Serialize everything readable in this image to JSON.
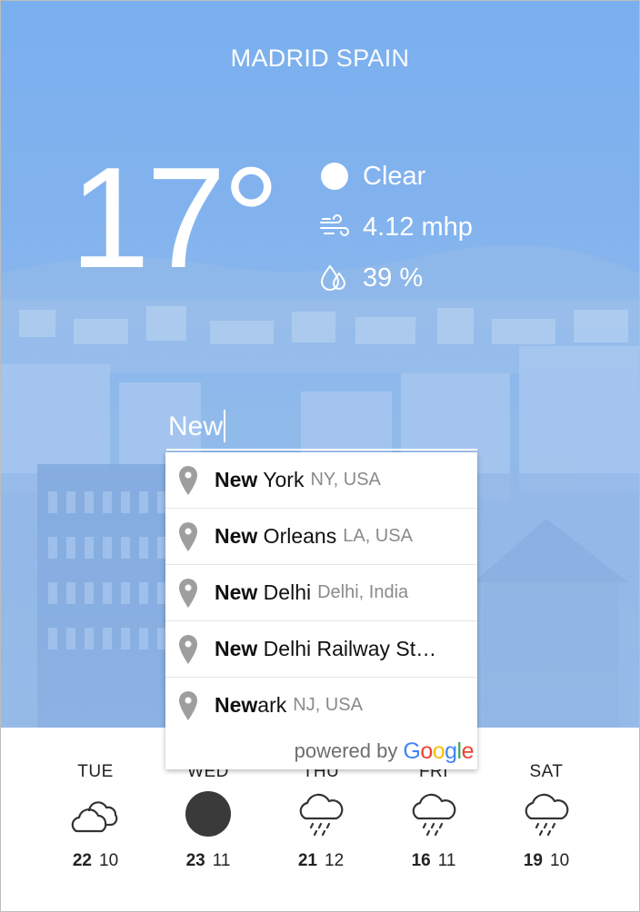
{
  "location": {
    "city": "MADRID",
    "country": "SPAIN"
  },
  "current": {
    "temperature": "17°",
    "condition": "Clear",
    "wind": "4.12 mhp",
    "humidity": "39 %"
  },
  "search": {
    "value": "New"
  },
  "suggestions": [
    {
      "match": "New",
      "rest": " York",
      "secondary": "NY, USA"
    },
    {
      "match": "New",
      "rest": " Orleans",
      "secondary": "LA, USA"
    },
    {
      "match": "New",
      "rest": " Delhi",
      "secondary": "Delhi, India"
    },
    {
      "match": "New",
      "rest": " Delhi Railway St…",
      "secondary": ""
    },
    {
      "match": "New",
      "rest": "ark",
      "secondary": "NJ, USA"
    }
  ],
  "attribution": {
    "prefix": "powered by",
    "brand": "Google"
  },
  "forecast": [
    {
      "day": "TUE",
      "high": "22",
      "low": "10",
      "icon": "cloudy-icon"
    },
    {
      "day": "WED",
      "high": "23",
      "low": "11",
      "icon": "sun-icon"
    },
    {
      "day": "THU",
      "high": "21",
      "low": "12",
      "icon": "rain-icon"
    },
    {
      "day": "FRI",
      "high": "16",
      "low": "11",
      "icon": "rain-icon"
    },
    {
      "day": "SAT",
      "high": "19",
      "low": "10",
      "icon": "rain-icon"
    }
  ],
  "colors": {
    "sky": "#79afee",
    "google_blue": "#4285F4",
    "google_red": "#EA4335",
    "google_yellow": "#FBBC05",
    "google_green": "#34A853"
  }
}
